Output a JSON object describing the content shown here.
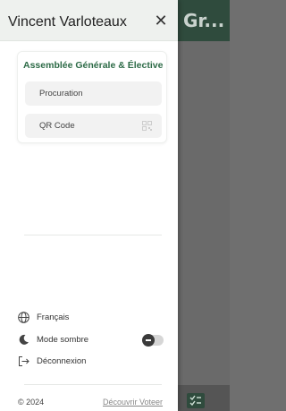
{
  "background": {
    "title": "Gr..."
  },
  "drawer": {
    "user_name": "Vincent Varloteaux",
    "close_glyph": "✕",
    "card": {
      "title": "Assemblée Générale & Élective",
      "items": [
        {
          "label": "Procuration"
        },
        {
          "label": "QR Code",
          "icon": "qr-code-icon"
        }
      ]
    },
    "settings": {
      "language": {
        "label": "Français",
        "icon": "globe-icon"
      },
      "dark_mode": {
        "label": "Mode sombre",
        "icon": "moon-icon",
        "enabled": false
      },
      "logout": {
        "label": "Déconnexion",
        "icon": "logout-icon"
      }
    },
    "footer": {
      "copyright": "© 2024",
      "link": "Découvrir Voteer"
    }
  },
  "colors": {
    "accent_green": "#2d6b47",
    "header_bg": "#eef1ee",
    "app_header": "#2f4b3d"
  }
}
